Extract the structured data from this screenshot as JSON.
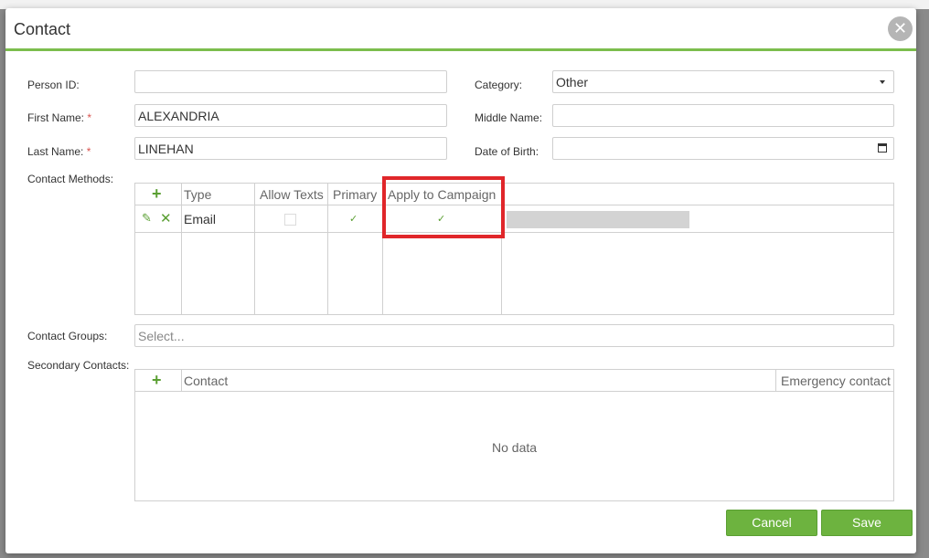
{
  "dialog": {
    "title": "Contact",
    "close_glyph": "✕"
  },
  "form": {
    "person_id": {
      "label": "Person ID:",
      "value": ""
    },
    "category": {
      "label": "Category:",
      "value": "Other"
    },
    "first_name": {
      "label": "First Name:",
      "required_mark": "*",
      "value": "ALEXANDRIA"
    },
    "middle_name": {
      "label": "Middle Name:",
      "value": ""
    },
    "last_name": {
      "label": "Last Name:",
      "required_mark": "*",
      "value": "LINEHAN"
    },
    "date_of_birth": {
      "label": "Date of Birth:",
      "value": ""
    }
  },
  "contact_methods": {
    "label": "Contact Methods:",
    "add_glyph": "+",
    "columns": [
      "Type",
      "Allow Texts",
      "Primary",
      "Apply to Campaign"
    ],
    "rows": [
      {
        "type": "Email",
        "allow_texts": false,
        "primary": true,
        "apply_to_campaign": true
      }
    ],
    "edit_glyph": "✎",
    "delete_glyph": "✕",
    "check_glyph": "✓"
  },
  "contact_groups": {
    "label": "Contact Groups:",
    "placeholder": "Select..."
  },
  "secondary_contacts": {
    "label": "Secondary Contacts:",
    "add_glyph": "+",
    "columns": [
      "Contact",
      "Emergency contact"
    ],
    "empty_text": "No data"
  },
  "buttons": {
    "cancel": "Cancel",
    "save": "Save"
  },
  "colors": {
    "accent": "#7cbd4d",
    "button": "#6db33f",
    "highlight": "#e0262a"
  }
}
